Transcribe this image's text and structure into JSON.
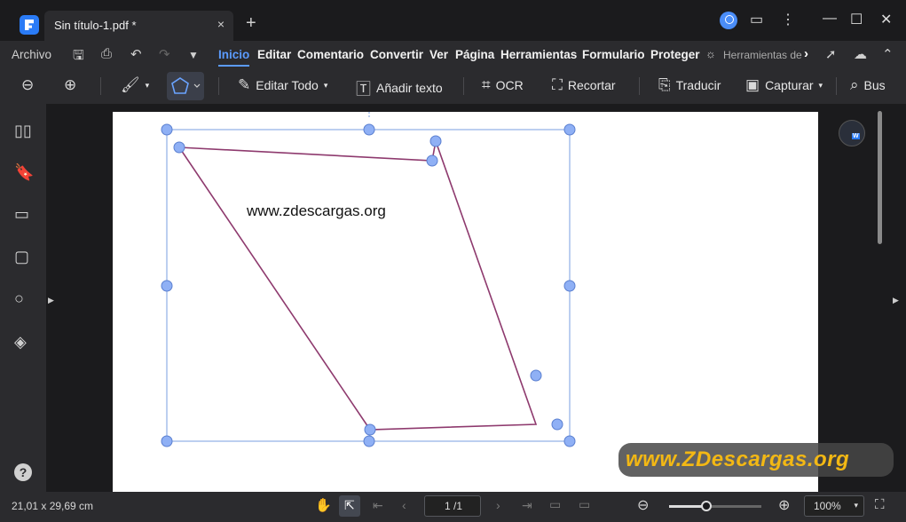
{
  "window": {
    "tab_title": "Sin título-1.pdf *",
    "close_tab": "×",
    "new_tab": "+",
    "minimize": "—",
    "maximize": "☐",
    "close": "✕"
  },
  "menu": {
    "archivo": "Archivo",
    "items": [
      "Inicio",
      "Editar",
      "Comentario",
      "Convertir",
      "Ver",
      "Página",
      "Herramientas",
      "Formulario",
      "Proteger"
    ],
    "active": "Inicio",
    "overflow": "Herramientas de"
  },
  "toolbar": {
    "edit_all": "Editar Todo",
    "add_text": "Añadir texto",
    "ocr": "OCR",
    "crop": "Recortar",
    "translate": "Traducir",
    "capture": "Capturar",
    "search": "Bus"
  },
  "document": {
    "text": "www.zdescargas.org"
  },
  "watermark": {
    "text": "www.ZDescargas.org"
  },
  "status": {
    "page_size": "21,01 x 29,69 cm",
    "page_indicator": "1 /1",
    "zoom_level": "100%",
    "zoom_fraction": 0.4
  },
  "colors": {
    "accent": "#5b9bff",
    "shape_stroke": "#8e3a6e",
    "handle": "#8fb0f5",
    "banner_text": "#f3b814"
  }
}
